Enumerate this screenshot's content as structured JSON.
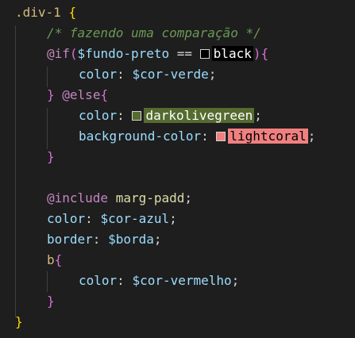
{
  "editor": {
    "lines": [
      {
        "tokens": [
          {
            "t": ".div-1",
            "c": "sel"
          },
          {
            "t": " ",
            "c": "plain"
          },
          {
            "t": "{",
            "c": "brace-y"
          }
        ]
      },
      {
        "tokens": [
          {
            "t": "/* fazendo uma comparação */",
            "c": "comment"
          }
        ]
      },
      {
        "tokens": [
          {
            "t": "@if",
            "c": "kw"
          },
          {
            "t": "(",
            "c": "brace-p"
          },
          {
            "t": "$fundo-preto",
            "c": "var"
          },
          {
            "t": " == ",
            "c": "op"
          },
          {
            "t": "black",
            "c": "hl hl-black",
            "swatch": "#000000"
          },
          {
            "t": ")",
            "c": "brace-p"
          },
          {
            "t": "{",
            "c": "brace-p"
          }
        ]
      },
      {
        "tokens": [
          {
            "t": "color",
            "c": "prop"
          },
          {
            "t": ": ",
            "c": "plain"
          },
          {
            "t": "$cor-verde",
            "c": "var"
          },
          {
            "t": ";",
            "c": "plain"
          }
        ]
      },
      {
        "tokens": [
          {
            "t": "}",
            "c": "brace-p"
          },
          {
            "t": " ",
            "c": "plain"
          },
          {
            "t": "@else",
            "c": "kw"
          },
          {
            "t": "{",
            "c": "brace-p"
          }
        ]
      },
      {
        "tokens": [
          {
            "t": "color",
            "c": "prop"
          },
          {
            "t": ": ",
            "c": "plain"
          },
          {
            "t": "darkolivegreen",
            "c": "hl hl-green",
            "swatch": "#556b2f"
          },
          {
            "t": ";",
            "c": "plain"
          }
        ]
      },
      {
        "tokens": [
          {
            "t": "background-color",
            "c": "prop"
          },
          {
            "t": ": ",
            "c": "plain"
          },
          {
            "t": "lightcoral",
            "c": "hl hl-coral",
            "swatch": "#f08080"
          },
          {
            "t": ";",
            "c": "plain"
          }
        ]
      },
      {
        "tokens": [
          {
            "t": "}",
            "c": "brace-p"
          }
        ]
      },
      {
        "tokens": []
      },
      {
        "tokens": [
          {
            "t": "@include",
            "c": "kw"
          },
          {
            "t": " ",
            "c": "plain"
          },
          {
            "t": "marg-padd",
            "c": "fn"
          },
          {
            "t": ";",
            "c": "plain"
          }
        ]
      },
      {
        "tokens": [
          {
            "t": "color",
            "c": "prop"
          },
          {
            "t": ": ",
            "c": "plain"
          },
          {
            "t": "$cor-azul",
            "c": "var"
          },
          {
            "t": ";",
            "c": "plain"
          }
        ]
      },
      {
        "tokens": [
          {
            "t": "border",
            "c": "prop"
          },
          {
            "t": ": ",
            "c": "plain"
          },
          {
            "t": "$borda",
            "c": "var"
          },
          {
            "t": ";",
            "c": "plain"
          }
        ]
      },
      {
        "tokens": [
          {
            "t": "b",
            "c": "sel"
          },
          {
            "t": "{",
            "c": "brace-p"
          }
        ]
      },
      {
        "tokens": [
          {
            "t": "color",
            "c": "prop"
          },
          {
            "t": ": ",
            "c": "plain"
          },
          {
            "t": "$cor-vermelho",
            "c": "var"
          },
          {
            "t": ";",
            "c": "plain"
          }
        ]
      },
      {
        "tokens": [
          {
            "t": "}",
            "c": "brace-p"
          }
        ]
      },
      {
        "tokens": [
          {
            "t": "}",
            "c": "brace-y"
          }
        ]
      }
    ]
  },
  "colors": {
    "background": "#1e1e1e",
    "selector": "#d7ba7d",
    "comment": "#6a9955",
    "keyword": "#c586c0",
    "variable": "#9cdcfe",
    "function": "#dcdcaa",
    "brace_level1": "#ffd700",
    "brace_level2": "#da70d6"
  }
}
